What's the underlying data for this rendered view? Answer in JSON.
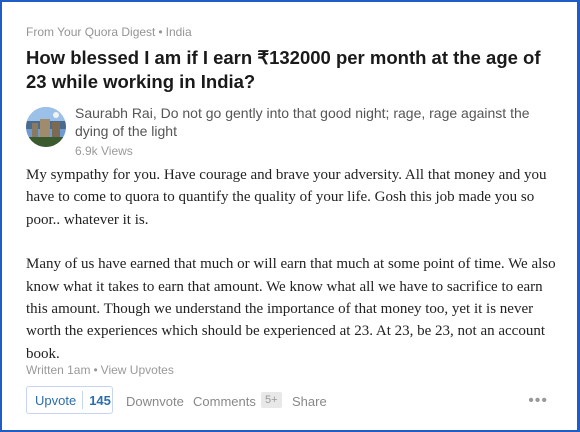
{
  "digest": {
    "source": "From Your Quora Digest",
    "separator": "•",
    "region": "India"
  },
  "question": {
    "title": "How blessed I am if I earn ₹132000 per month at the age of 23 while working in India?"
  },
  "author": {
    "name": "Saurabh Rai",
    "credential": ", Do not go gently into that good night; rage, rage against the dying of the light",
    "views": "6.9k Views"
  },
  "answer": {
    "paragraphs": [
      "My sympathy for you. Have courage and brave your adversity. All that money and you have to come to quora to quantify the quality of your life. Gosh this job made you so poor.. whatever it is.",
      "Many of us have earned that much or will earn that much at some point of time. We also know what it takes to earn that amount. We know what all we have to sacrifice to earn this amount. Though we understand the importance of that money too,  yet it is never worth the experiences which should be experienced at 23.  At 23, be 23, not an account book."
    ]
  },
  "meta": {
    "written": "Written 1am",
    "separator": "•",
    "view_upvotes": "View Upvotes"
  },
  "actions": {
    "upvote_label": "Upvote",
    "upvote_count": "145",
    "downvote_label": "Downvote",
    "comments_label": "Comments",
    "comments_count": "5+",
    "share_label": "Share",
    "more_label": "•••"
  },
  "colors": {
    "frame_border": "#1f5cc6",
    "upvote_blue": "#2b6dad"
  },
  "icons": {
    "avatar": "author-avatar-photo"
  }
}
